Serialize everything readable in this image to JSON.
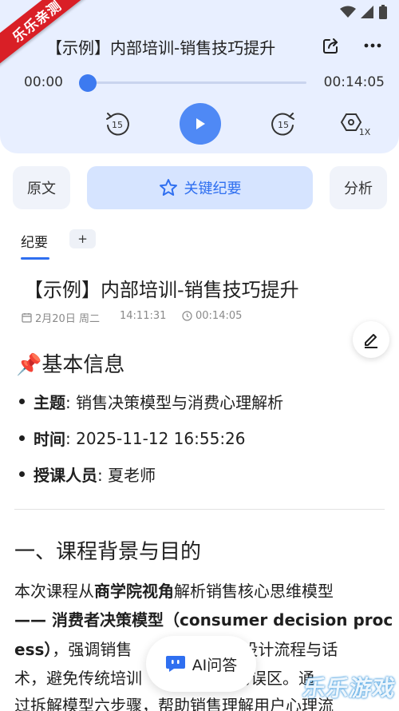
{
  "watermark_badge": "乐乐亲测",
  "watermark_corner": "乐乐游戏",
  "header": {
    "title": "【示例】内部培训-销售技巧提升",
    "share_icon": "share-icon",
    "more_icon": "more-icon"
  },
  "player": {
    "elapsed": "00:00",
    "total": "00:14:05",
    "progress": 0.0,
    "rewind_seconds": "15",
    "forward_seconds": "15",
    "speed": "1X"
  },
  "tabs": {
    "original": "原文",
    "key_summary": "关键纪要",
    "analysis": "分析"
  },
  "subtabs": {
    "summary": "纪要",
    "add": "+"
  },
  "document": {
    "title": "【示例】内部培训-销售技巧提升",
    "date": "2月20日 周二",
    "time": "14:11:31",
    "duration": "00:14:05",
    "basic_info_heading": "📌基本信息",
    "bullets": [
      {
        "label": "主题",
        "value": ": 销售决策模型与消费心理解析"
      },
      {
        "label": "时间",
        "value": ": 2025-11-12 16:55:26"
      },
      {
        "label": "授课人员",
        "value": ": 夏老师"
      }
    ],
    "section_heading": "一、课程背景与目的",
    "paragraph": {
      "l1_a": "本次课程从",
      "l1_b": "商学院视角",
      "l1_c": "解析销售核心思维模型",
      "l2_a": "—— ",
      "l2_b": "消费者决策模型（consumer decision proc",
      "l3_a": "ess）",
      "l3_b": "，强调销售",
      "l3_c": "角设计流程与话",
      "l4_a": "术，避免传统培训",
      "l4_b": "点的误区。通",
      "l5": "过拆解模型六步骤，帮助销售理解用户心理流"
    }
  },
  "ai_button": {
    "label": "AI问答"
  },
  "colors": {
    "accent": "#2f6ff0",
    "player_bg": "#e8efff",
    "play_button": "#4f89f5"
  }
}
